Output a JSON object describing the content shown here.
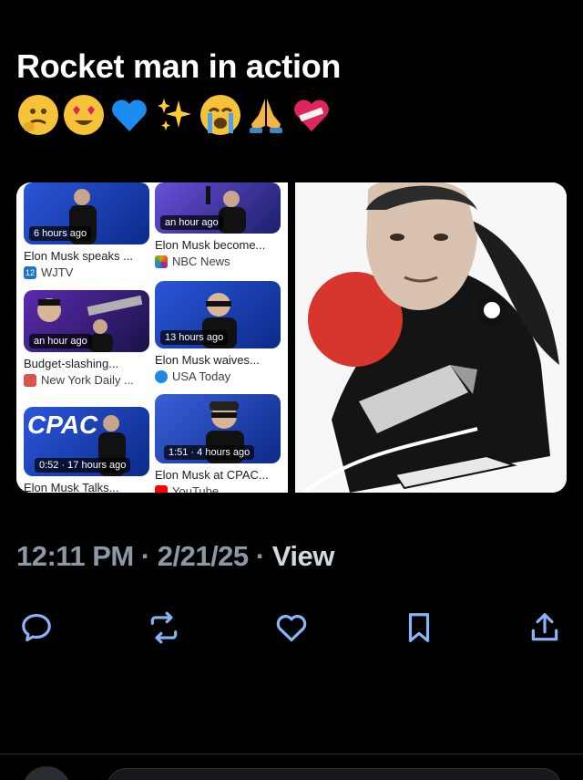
{
  "post": {
    "text": "Rocket man in action",
    "emojis": [
      "thinking-face",
      "heart-eyes-face",
      "blue-heart",
      "sparkles",
      "crying-face",
      "folded-hands",
      "mending-heart"
    ]
  },
  "media": {
    "news_cards": [
      {
        "time": "6 hours ago",
        "title": "Elon Musk speaks ...",
        "source": "WJTV",
        "source_icon": "12",
        "source_color": "#1e73c8"
      },
      {
        "time": "an hour ago",
        "title": "Elon Musk become...",
        "source": "NBC News",
        "source_icon": "",
        "source_color": "#e0a000"
      },
      {
        "time": "an hour ago",
        "title": "Budget-slashing...",
        "source": "New York Daily ...",
        "source_icon": "",
        "source_color": "#d9534f"
      },
      {
        "time": "13 hours ago",
        "title": "Elon Musk waives...",
        "source": "USA Today",
        "source_icon": "",
        "source_color": "#1e88e5"
      },
      {
        "time": "0:52 · 17 hours ago",
        "title": "Elon Musk Talks...",
        "source": "",
        "source_icon": "",
        "source_color": "#999999"
      },
      {
        "time": "1:51 · 4 hours ago",
        "title": "Elon Musk at CPAC...",
        "source": "YouTube",
        "source_icon": "",
        "source_color": "#ff0000"
      }
    ],
    "thumb_text": "CPAC"
  },
  "timestamp": {
    "text": "12:11 PM · 2/21/25 · ",
    "view": "View"
  },
  "actions": [
    "reply-icon",
    "repost-icon",
    "like-icon",
    "bookmark-icon",
    "share-icon"
  ],
  "colors": {
    "background": "#000000",
    "muted": "#8b98a5",
    "icon": "#8ab4f8"
  }
}
